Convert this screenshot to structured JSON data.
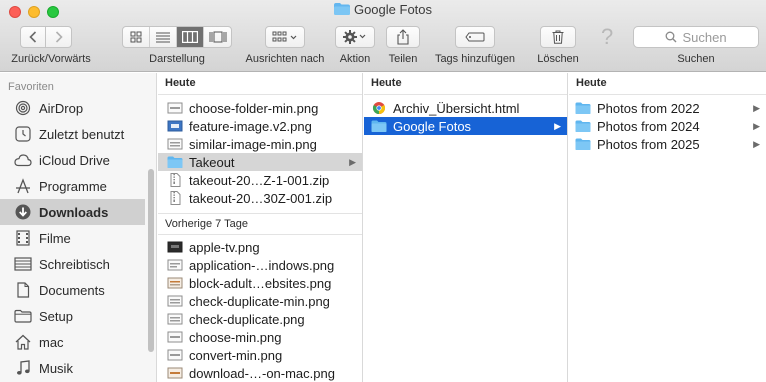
{
  "window": {
    "title": "Google Fotos"
  },
  "toolbar": {
    "back_forward_label": "Zurück/Vorwärts",
    "view_label": "Darstellung",
    "arrange_label": "Ausrichten nach",
    "action_label": "Aktion",
    "share_label": "Teilen",
    "tags_label": "Tags hinzufügen",
    "delete_label": "Löschen",
    "search_label": "Suchen",
    "search_placeholder": "Suchen",
    "active_view": "columns"
  },
  "sidebar": {
    "header": "Favoriten",
    "items": [
      {
        "label": "AirDrop",
        "icon": "airdrop-icon"
      },
      {
        "label": "Zuletzt benutzt",
        "icon": "recents-icon"
      },
      {
        "label": "iCloud Drive",
        "icon": "icloud-icon"
      },
      {
        "label": "Programme",
        "icon": "applications-icon"
      },
      {
        "label": "Downloads",
        "icon": "downloads-icon",
        "selected": true
      },
      {
        "label": "Filme",
        "icon": "movies-icon"
      },
      {
        "label": "Schreibtisch",
        "icon": "desktop-icon"
      },
      {
        "label": "Documents",
        "icon": "documents-icon"
      },
      {
        "label": "Setup",
        "icon": "folder-icon"
      },
      {
        "label": "mac",
        "icon": "home-icon"
      },
      {
        "label": "Musik",
        "icon": "music-icon"
      }
    ]
  },
  "column1": {
    "header_today": "Heute",
    "today": [
      {
        "name": "choose-folder-min.png",
        "kind": "image"
      },
      {
        "name": "feature-image.v2.png",
        "kind": "image-blue"
      },
      {
        "name": "similar-image-min.png",
        "kind": "image"
      },
      {
        "name": "Takeout",
        "kind": "folder",
        "selected": true
      },
      {
        "name": "takeout-20…Z-1-001.zip",
        "kind": "zip"
      },
      {
        "name": "takeout-20…30Z-001.zip",
        "kind": "zip"
      }
    ],
    "header_prev": "Vorherige 7 Tage",
    "previous": [
      {
        "name": "apple-tv.png",
        "kind": "image-dark"
      },
      {
        "name": "application-…indows.png",
        "kind": "image"
      },
      {
        "name": "block-adult…ebsites.png",
        "kind": "image-warm"
      },
      {
        "name": "check-duplicate-min.png",
        "kind": "image"
      },
      {
        "name": "check-duplicate.png",
        "kind": "image"
      },
      {
        "name": "choose-min.png",
        "kind": "image"
      },
      {
        "name": "convert-min.png",
        "kind": "image"
      },
      {
        "name": "download-…-on-mac.png",
        "kind": "image-warm"
      }
    ]
  },
  "column2": {
    "header": "Heute",
    "items": [
      {
        "name": "Archiv_Übersicht.html",
        "kind": "html"
      },
      {
        "name": "Google Fotos",
        "kind": "folder",
        "selected": true
      }
    ]
  },
  "column3": {
    "header": "Heute",
    "items": [
      {
        "name": "Photos from 2022",
        "kind": "folder"
      },
      {
        "name": "Photos from 2024",
        "kind": "folder"
      },
      {
        "name": "Photos from 2025",
        "kind": "folder"
      }
    ]
  },
  "colors": {
    "selection_blue": "#1763d6",
    "folder_blue": "#5fb6ef",
    "sidebar_bg": "#f6f6f6"
  }
}
